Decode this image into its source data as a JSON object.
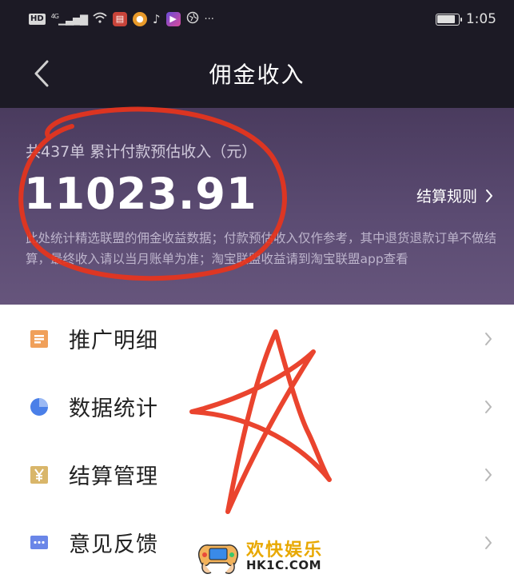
{
  "status_bar": {
    "hd_label": "HD",
    "network_label": "4G",
    "dots": "···",
    "time": "1:05"
  },
  "nav": {
    "title": "佣金收入"
  },
  "earnings": {
    "summary": "共437单 累计付款预估收入（元）",
    "amount": "11023.91",
    "rules_label": "结算规则",
    "notice": "此处统计精选联盟的佣金收益数据；付款预估收入仅作参考，其中退货退款订单不做结算，最终收入请以当月账单为准；淘宝联盟收益请到淘宝联盟app查看"
  },
  "menu": {
    "items": [
      {
        "label": "推广明细",
        "icon": "document-list-icon",
        "color": "#f0a05a"
      },
      {
        "label": "数据统计",
        "icon": "pie-chart-icon",
        "color": "#4a7fe8"
      },
      {
        "label": "结算管理",
        "icon": "yen-icon",
        "color": "#d9b66a"
      },
      {
        "label": "意见反馈",
        "icon": "chat-bubble-icon",
        "color": "#6a86e8"
      }
    ]
  },
  "watermark": {
    "main": "欢快娱乐",
    "sub": "HK1C.COM"
  },
  "colors": {
    "dark_bg": "#1c1a25",
    "header_purple": "#5b4b72",
    "annotation_red": "#e8341c"
  }
}
